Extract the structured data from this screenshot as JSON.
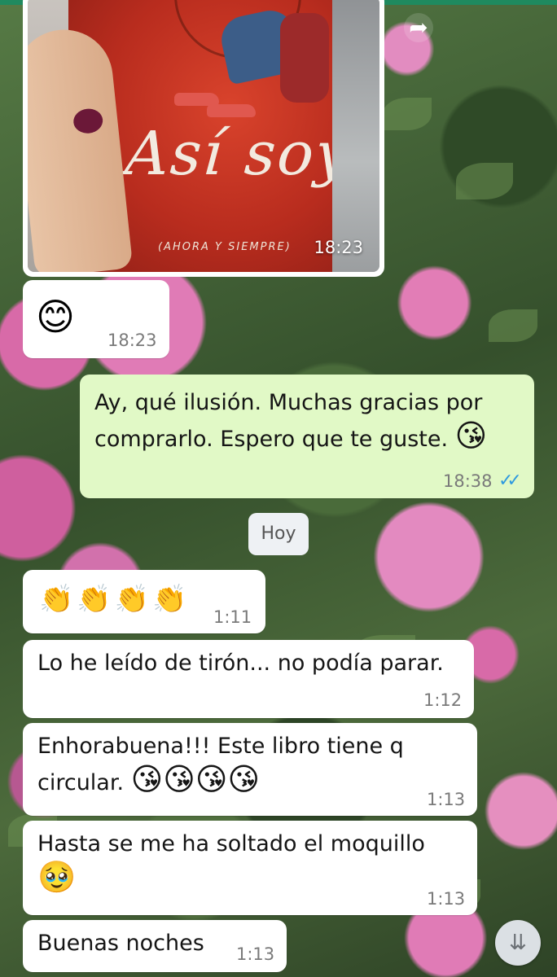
{
  "image_message": {
    "time": "18:23",
    "book_title": "Así soy",
    "book_subtitle": "(AHORA Y SIEMPRE)"
  },
  "messages": [
    {
      "dir": "in",
      "text": "",
      "emoji": "😊",
      "time": "18:23"
    },
    {
      "dir": "out",
      "text": "Ay, qué ilusión. Muchas gracias por comprarlo. Espero que te guste.",
      "emoji": "😘",
      "time": "18:38",
      "status": "read"
    },
    {
      "dir": "in",
      "text": "",
      "emoji": "👏👏👏👏",
      "time": "1:11"
    },
    {
      "dir": "in",
      "text": "Lo he leído de tirón... no podía parar.",
      "time": "1:12"
    },
    {
      "dir": "in",
      "text": "Enhorabuena!!! Este libro tiene q circular.",
      "emoji": "😘😘😘😘",
      "time": "1:13"
    },
    {
      "dir": "in",
      "text": "Hasta se me ha soltado el moquillo",
      "emoji": "🥹",
      "time": "1:13"
    },
    {
      "dir": "in",
      "text": "Buenas noches",
      "time": "1:13"
    }
  ],
  "date_separator": "Hoy",
  "icons": {
    "share": "share-forward-icon",
    "read_receipt": "double-check-icon",
    "scroll_down": "double-chevron-down-icon"
  },
  "colors": {
    "incoming_bubble": "#ffffff",
    "outgoing_bubble": "#e1f9c6",
    "read_tick": "#2e9adf"
  }
}
